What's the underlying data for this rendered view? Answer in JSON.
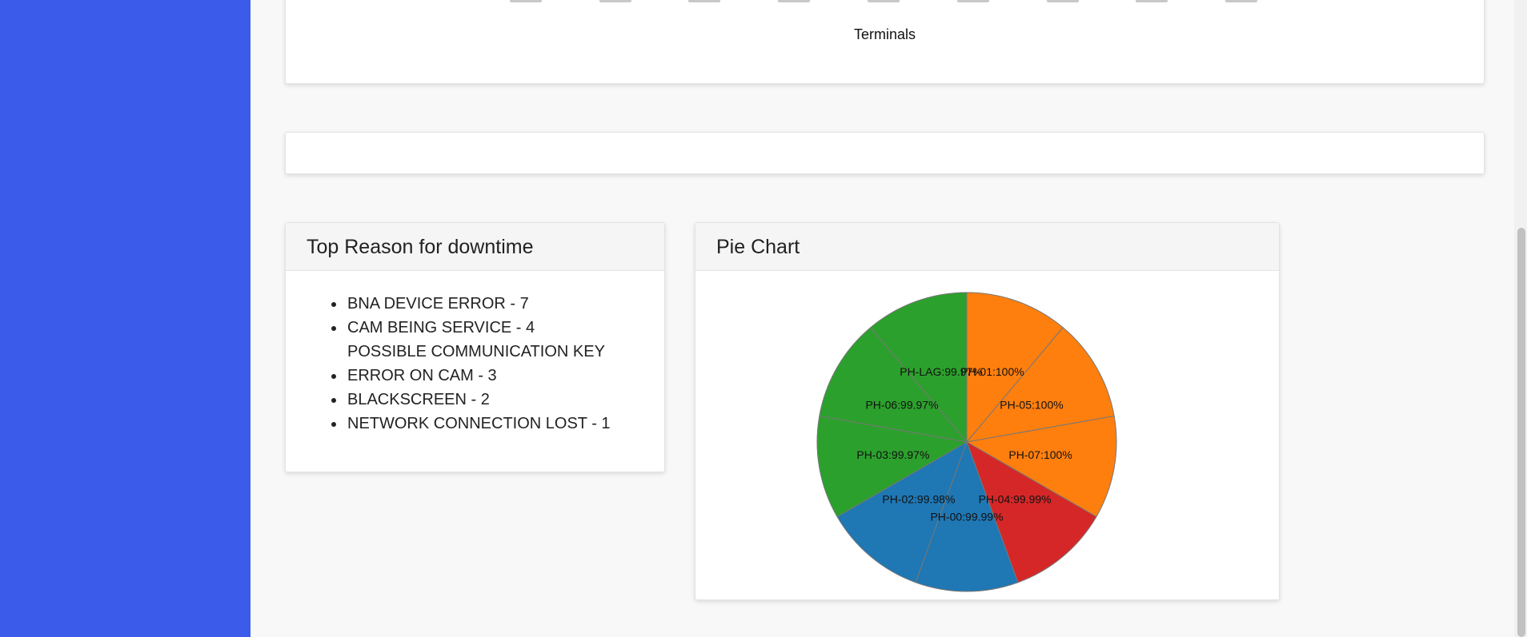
{
  "colors": {
    "sidebar": "#3b5bea",
    "pie_orange": "#ff7f0e",
    "pie_red": "#d62728",
    "pie_blue": "#1f77b4",
    "pie_green": "#2ca02c"
  },
  "top_chart": {
    "xlabel": "Terminals"
  },
  "reasons": {
    "title": "Top Reason for downtime",
    "items": [
      "BNA DEVICE ERROR - 7",
      "CAM BEING SERVICE - 4",
      "POSSIBLE COMMUNICATION KEY ERROR ON CAM - 3",
      "BLACKSCREEN - 2",
      "NETWORK CONNECTION LOST - 1"
    ]
  },
  "pie": {
    "title": "Pie Chart"
  },
  "chart_data": {
    "type": "pie",
    "title": "Pie Chart",
    "slices": [
      {
        "label": "PH-01:100%",
        "value": 1,
        "color": "#ff7f0e"
      },
      {
        "label": "PH-05:100%",
        "value": 1,
        "color": "#ff7f0e"
      },
      {
        "label": "PH-07:100%",
        "value": 1,
        "color": "#ff7f0e"
      },
      {
        "label": "PH-04:99.99%",
        "value": 1,
        "color": "#d62728"
      },
      {
        "label": "PH-00:99.99%",
        "value": 1,
        "color": "#1f77b4"
      },
      {
        "label": "PH-02:99.98%",
        "value": 1,
        "color": "#1f77b4"
      },
      {
        "label": "PH-03:99.97%",
        "value": 1,
        "color": "#2ca02c"
      },
      {
        "label": "PH-06:99.97%",
        "value": 1,
        "color": "#2ca02c"
      },
      {
        "label": "PH-LAG:99.97%",
        "value": 1,
        "color": "#2ca02c"
      }
    ]
  }
}
